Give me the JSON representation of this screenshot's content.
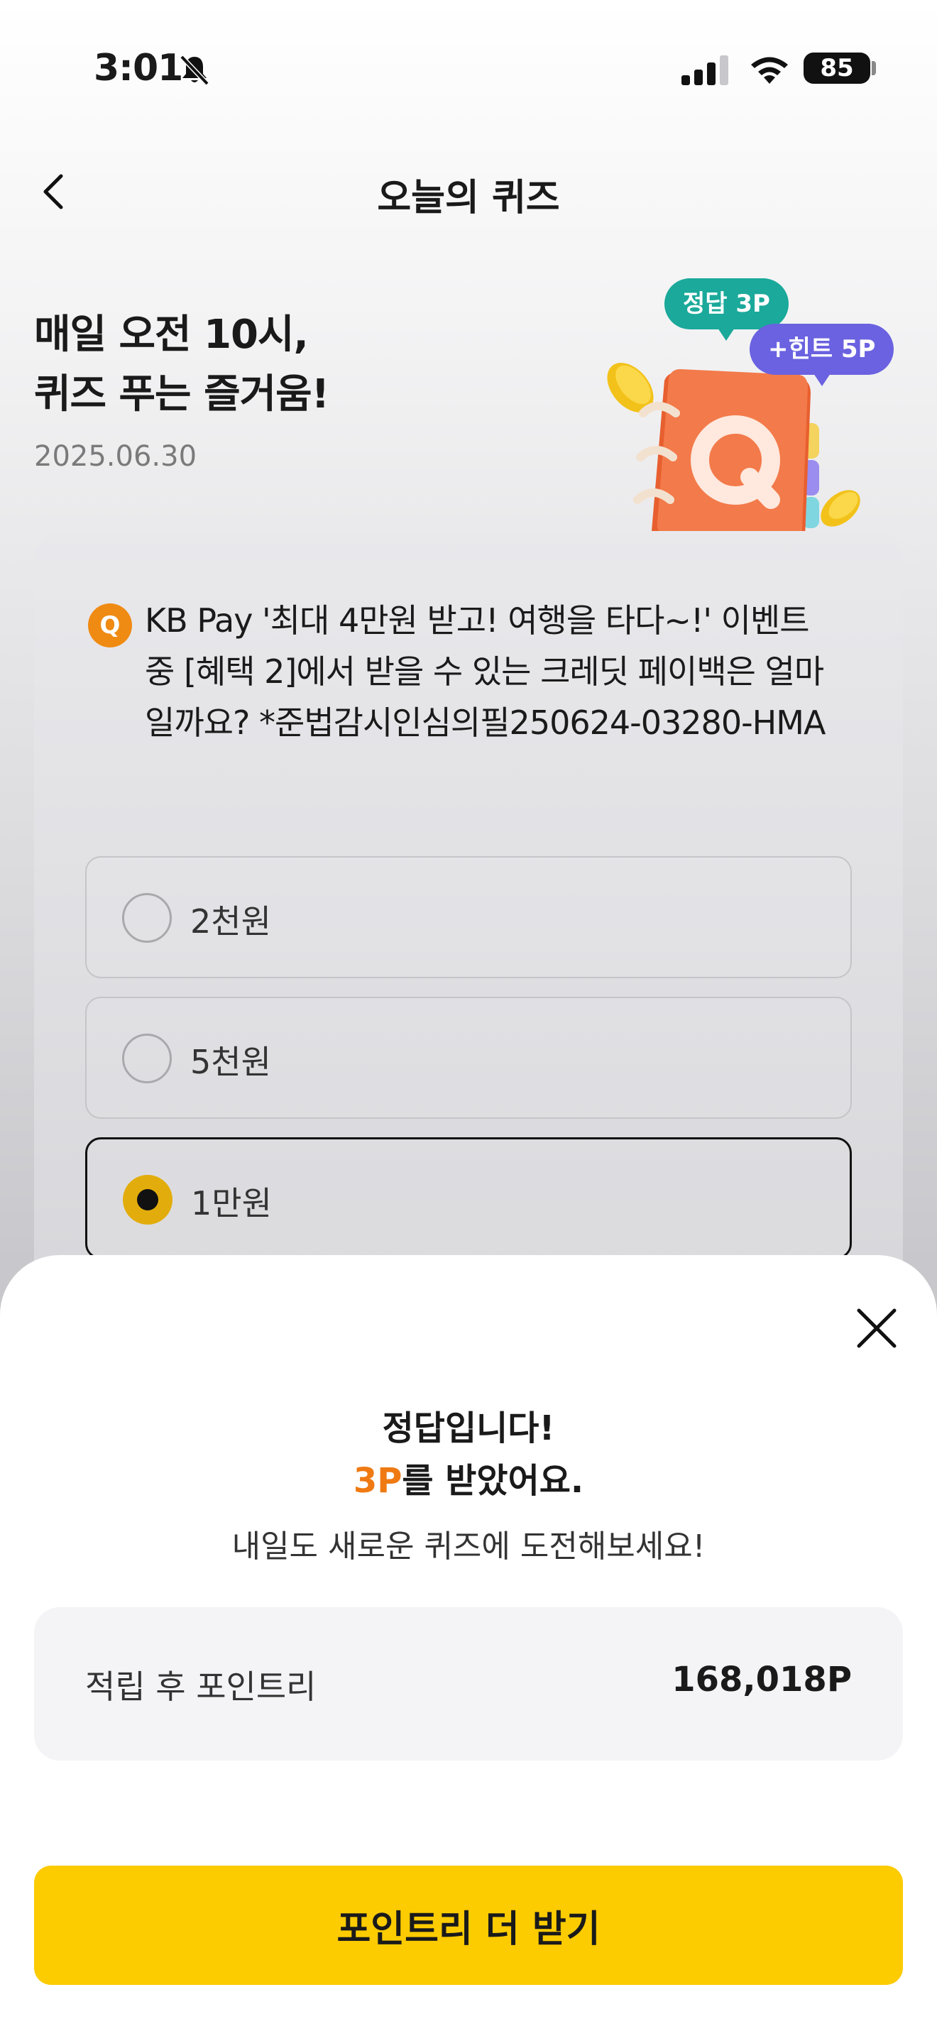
{
  "status_bar": {
    "time": "3:01",
    "battery": "85"
  },
  "header": {
    "title": "오늘의 퀴즈"
  },
  "hero": {
    "title_line1": "매일 오전 10시,",
    "title_line2": "퀴즈 푸는 즐거움!",
    "date": "2025.06.30",
    "tag_answer": "정답 3P",
    "tag_hint": "+힌트 5P"
  },
  "quiz": {
    "badge": "Q",
    "question": "KB Pay '최대 4만원 받고! 여행을 타다~!' 이벤트 중 [혜택 2]에서 받을 수 있는 크레딧 페이백은 얼마일까요? *준법감시인심의필250624-03280-HMA",
    "options": [
      {
        "label": "2천원",
        "selected": false
      },
      {
        "label": "5천원",
        "selected": false
      },
      {
        "label": "1만원",
        "selected": true
      }
    ]
  },
  "result_sheet": {
    "line1": "정답입니다!",
    "points_awarded": "3P",
    "line2_suffix": "를 받았어요.",
    "sub": "내일도 새로운 퀴즈에 도전해보세요!",
    "points_label": "적립 후 포인트리",
    "points_value": "168,018P",
    "cta_label": "포인트리 더 받기"
  },
  "colors": {
    "accent": "#fccb00",
    "points": "#ef7a12",
    "tag_answer": "#1aa99a",
    "tag_hint": "#6a62e0"
  }
}
